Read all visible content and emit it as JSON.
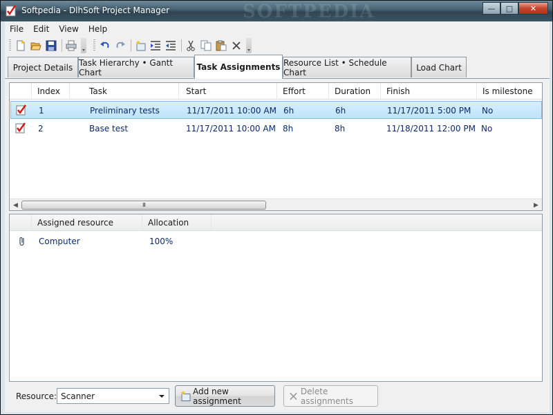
{
  "window": {
    "title": "Softpedia - DlhSoft Project Manager",
    "watermark": "SOFTPEDIA",
    "buttons": {
      "minimize": "—",
      "maximize": "□",
      "close": "✕"
    }
  },
  "menu": [
    "File",
    "Edit",
    "View",
    "Help"
  ],
  "toolbar": {
    "icons": [
      "new-icon",
      "open-icon",
      "save-icon",
      "print-icon",
      "undo-icon",
      "redo-icon",
      "add-task-icon",
      "indent-icon",
      "outdent-icon",
      "cut-icon",
      "copy-icon",
      "paste-icon",
      "delete-icon"
    ]
  },
  "tabs": [
    {
      "label": "Project Details",
      "active": false
    },
    {
      "label": "Task Hierarchy • Gantt Chart",
      "active": false
    },
    {
      "label": "Task Assignments",
      "active": true
    },
    {
      "label": "Resource List • Schedule Chart",
      "active": false
    },
    {
      "label": "Load Chart",
      "active": false
    }
  ],
  "tasks": {
    "columns": [
      "Index",
      "Task",
      "Start",
      "Effort",
      "Duration",
      "Finish",
      "Is milestone"
    ],
    "rows": [
      {
        "index": "1",
        "task": "Preliminary tests",
        "start": "11/17/2011 10:00 AM",
        "effort": "6h",
        "duration": "6h",
        "finish": "11/17/2011 5:00 PM",
        "milestone": "No",
        "selected": true
      },
      {
        "index": "2",
        "task": "Base test",
        "start": "11/17/2011 10:00 AM",
        "effort": "8h",
        "duration": "8h",
        "finish": "11/18/2011 12:00 PM",
        "milestone": "No",
        "selected": false
      }
    ],
    "scroll_thumb": "III"
  },
  "assignments": {
    "columns": [
      "Assigned resource",
      "Allocation"
    ],
    "rows": [
      {
        "resource": "Computer",
        "allocation": "100%"
      }
    ]
  },
  "bottom": {
    "resource_label": "Resource:",
    "resource_value": "Scanner",
    "add_label": "Add new assignment",
    "delete_label": "Delete assignments"
  }
}
